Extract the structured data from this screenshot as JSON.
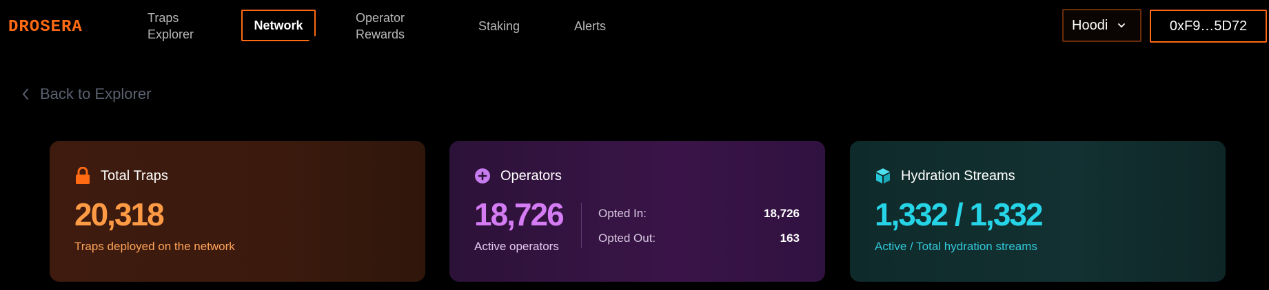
{
  "brand": {
    "name": "DROSERA",
    "color": "#ff6a13"
  },
  "nav": {
    "traps_explorer": [
      "Traps",
      "Explorer"
    ],
    "network": "Network",
    "operator_rewards": [
      "Operator",
      "Rewards"
    ],
    "staking": "Staking",
    "alerts": "Alerts"
  },
  "header": {
    "chain": "Hoodi",
    "wallet": "0xF9…5D72"
  },
  "back_link": "Back to Explorer",
  "cards": {
    "traps": {
      "title": "Total Traps",
      "value": "20,318",
      "subtitle": "Traps deployed on the network",
      "icon": "lock-icon"
    },
    "operators": {
      "title": "Operators",
      "value": "18,726",
      "subtitle": "Active operators",
      "icon": "plus-circle-icon",
      "opted_in_label": "Opted In:",
      "opted_in_value": "18,726",
      "opted_out_label": "Opted Out:",
      "opted_out_value": "163"
    },
    "hydration": {
      "title": "Hydration Streams",
      "value": "1,332 / 1,332",
      "subtitle": "Active / Total hydration streams",
      "icon": "cube-icon"
    }
  },
  "colors": {
    "accent": "#ff6a13",
    "traps": "#ff9a45",
    "operators": "#d57cf4",
    "hydration": "#25d4e6"
  }
}
